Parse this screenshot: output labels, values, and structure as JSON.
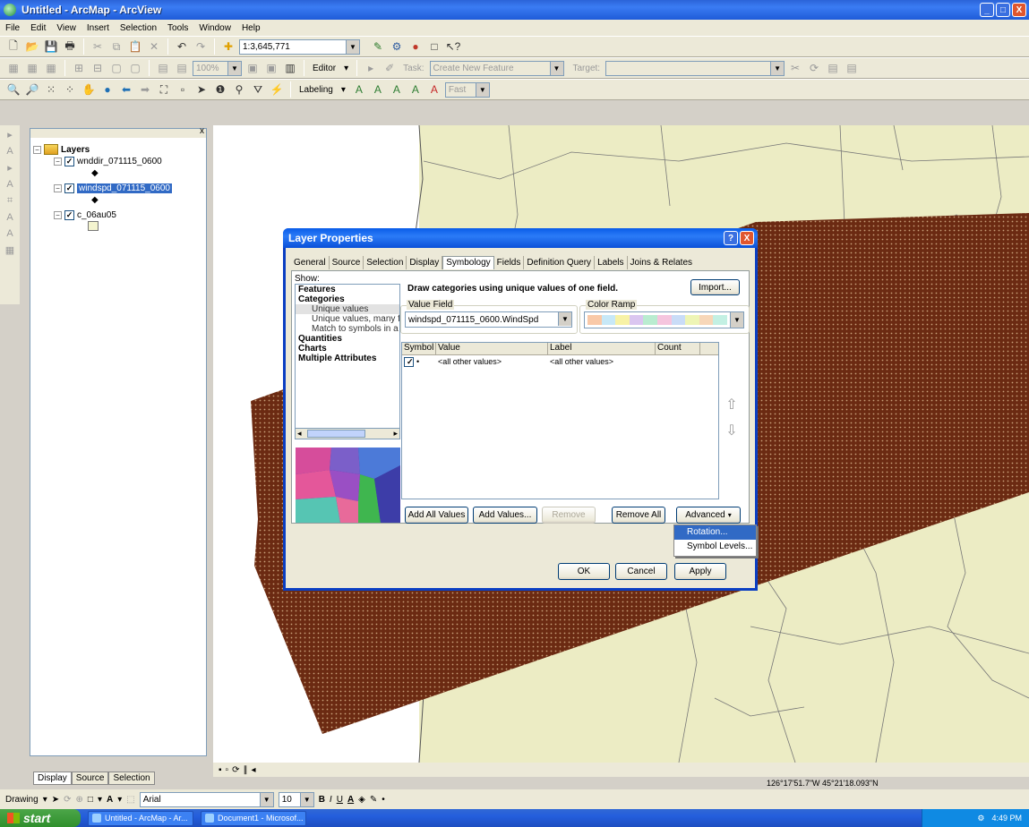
{
  "window": {
    "title": "Untitled - ArcMap - ArcView",
    "buttons": [
      "_",
      "□",
      "X"
    ]
  },
  "menu": [
    "File",
    "Edit",
    "View",
    "Insert",
    "Selection",
    "Tools",
    "Window",
    "Help"
  ],
  "toolbar1": {
    "scale": "1:3,645,771"
  },
  "toolbar2": {
    "zoom_value": "100%",
    "editor_label": "Editor",
    "task_label": "Task:",
    "task_value": "Create New Feature",
    "target_label": "Target:"
  },
  "toolbar3": {
    "labeling_label": "Labeling",
    "font_value": "Fast"
  },
  "toc": {
    "root": "Layers",
    "layers": [
      {
        "name": "wnddir_071115_0600"
      },
      {
        "name": "windspd_071115_0600"
      },
      {
        "name": "c_06au05"
      }
    ],
    "tabs": [
      "Display",
      "Source",
      "Selection"
    ]
  },
  "dialog": {
    "title": "Layer Properties",
    "tabs": [
      "General",
      "Source",
      "Selection",
      "Display",
      "Symbology",
      "Fields",
      "Definition Query",
      "Labels",
      "Joins & Relates"
    ],
    "active_tab": "Symbology",
    "show_label": "Show:",
    "show_list": [
      {
        "label": "Features",
        "kind": "bold"
      },
      {
        "label": "Categories",
        "kind": "bold"
      },
      {
        "label": "Unique values",
        "kind": "sub-selected"
      },
      {
        "label": "Unique values, many f",
        "kind": "sub"
      },
      {
        "label": "Match to symbols in a",
        "kind": "sub"
      },
      {
        "label": "Quantities",
        "kind": "bold"
      },
      {
        "label": "Charts",
        "kind": "bold"
      },
      {
        "label": "Multiple Attributes",
        "kind": "bold"
      }
    ],
    "description": "Draw categories using unique values of one field.",
    "import_button": "Import...",
    "value_field_label": "Value Field",
    "value_field": "windspd_071115_0600.WindSpd",
    "color_ramp_label": "Color Ramp",
    "ramp_colors": [
      "#f9c9a8",
      "#c7e8f7",
      "#f7f2a6",
      "#dac6f0",
      "#b9ecd0",
      "#f5c5de",
      "#c9dcf7",
      "#eef5b5",
      "#f7d7b9",
      "#c3f0e3"
    ],
    "table": {
      "columns": [
        "Symbol",
        "Value",
        "Label",
        "Count"
      ],
      "rows": [
        {
          "value": "<all other values>",
          "label": "<all other values>",
          "count": ""
        }
      ]
    },
    "buttons": {
      "add_all": "Add All Values",
      "add": "Add Values...",
      "remove": "Remove",
      "remove_all": "Remove All",
      "advanced": "Advanced"
    },
    "advanced_menu": [
      "Rotation...",
      "Symbol Levels..."
    ],
    "footer": {
      "ok": "OK",
      "cancel": "Cancel",
      "apply": "Apply"
    }
  },
  "drawing": {
    "label": "Drawing",
    "font": "Arial",
    "size": "10"
  },
  "status": {
    "coords": "126°17'51.7\"W 45°21'18.093\"N"
  },
  "taskbar": {
    "start": "start",
    "tasks": [
      "Untitled - ArcMap - Ar...",
      "Document1 - Microsof..."
    ],
    "clock": "4:49 PM"
  },
  "colors": {
    "map_land": "#ececc4",
    "grid_points": "#6b2a12",
    "xp_blue": "#0a50d8"
  }
}
